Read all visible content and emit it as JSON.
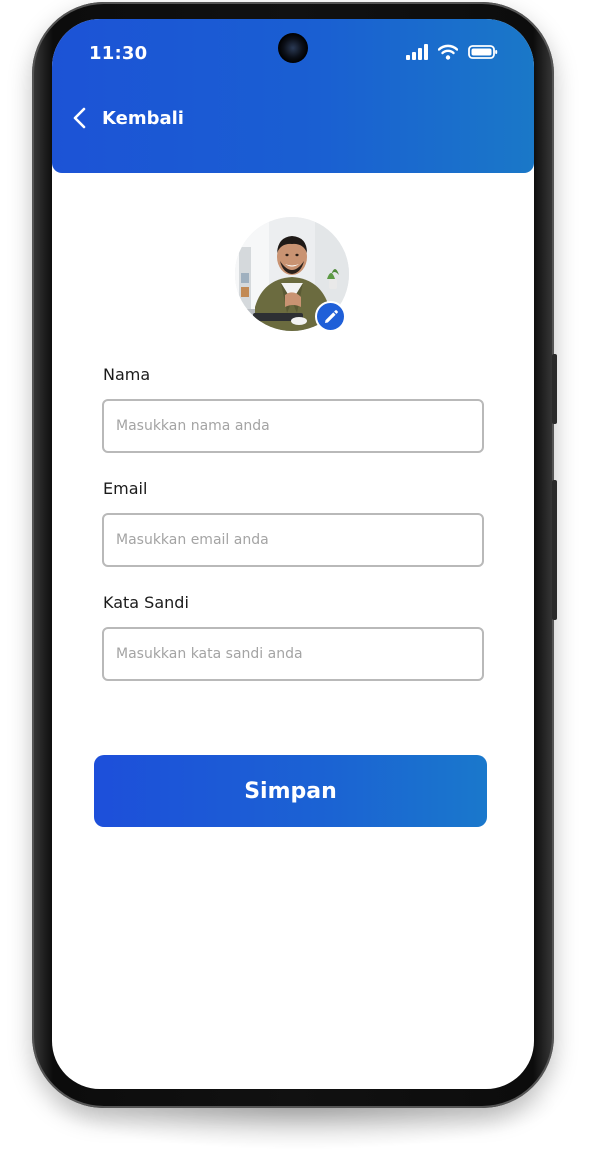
{
  "status_bar": {
    "time": "11:30"
  },
  "header": {
    "back_label": "Kembali",
    "back_icon": "chevron-left-icon",
    "background_start": "#1c53d6",
    "background_end": "#1a78c8"
  },
  "profile": {
    "avatar_icon": "profile-photo",
    "edit_icon": "pencil-icon",
    "edit_badge_color": "#1f5fd8"
  },
  "form": {
    "fields": [
      {
        "label": "Nama",
        "value": "",
        "placeholder": "Masukkan nama anda",
        "type": "text"
      },
      {
        "label": "Email",
        "value": "",
        "placeholder": "Masukkan email anda",
        "type": "email"
      },
      {
        "label": "Kata Sandi",
        "value": "",
        "placeholder": "Masukkan kata sandi anda",
        "type": "password"
      }
    ],
    "save_label": "Simpan"
  }
}
